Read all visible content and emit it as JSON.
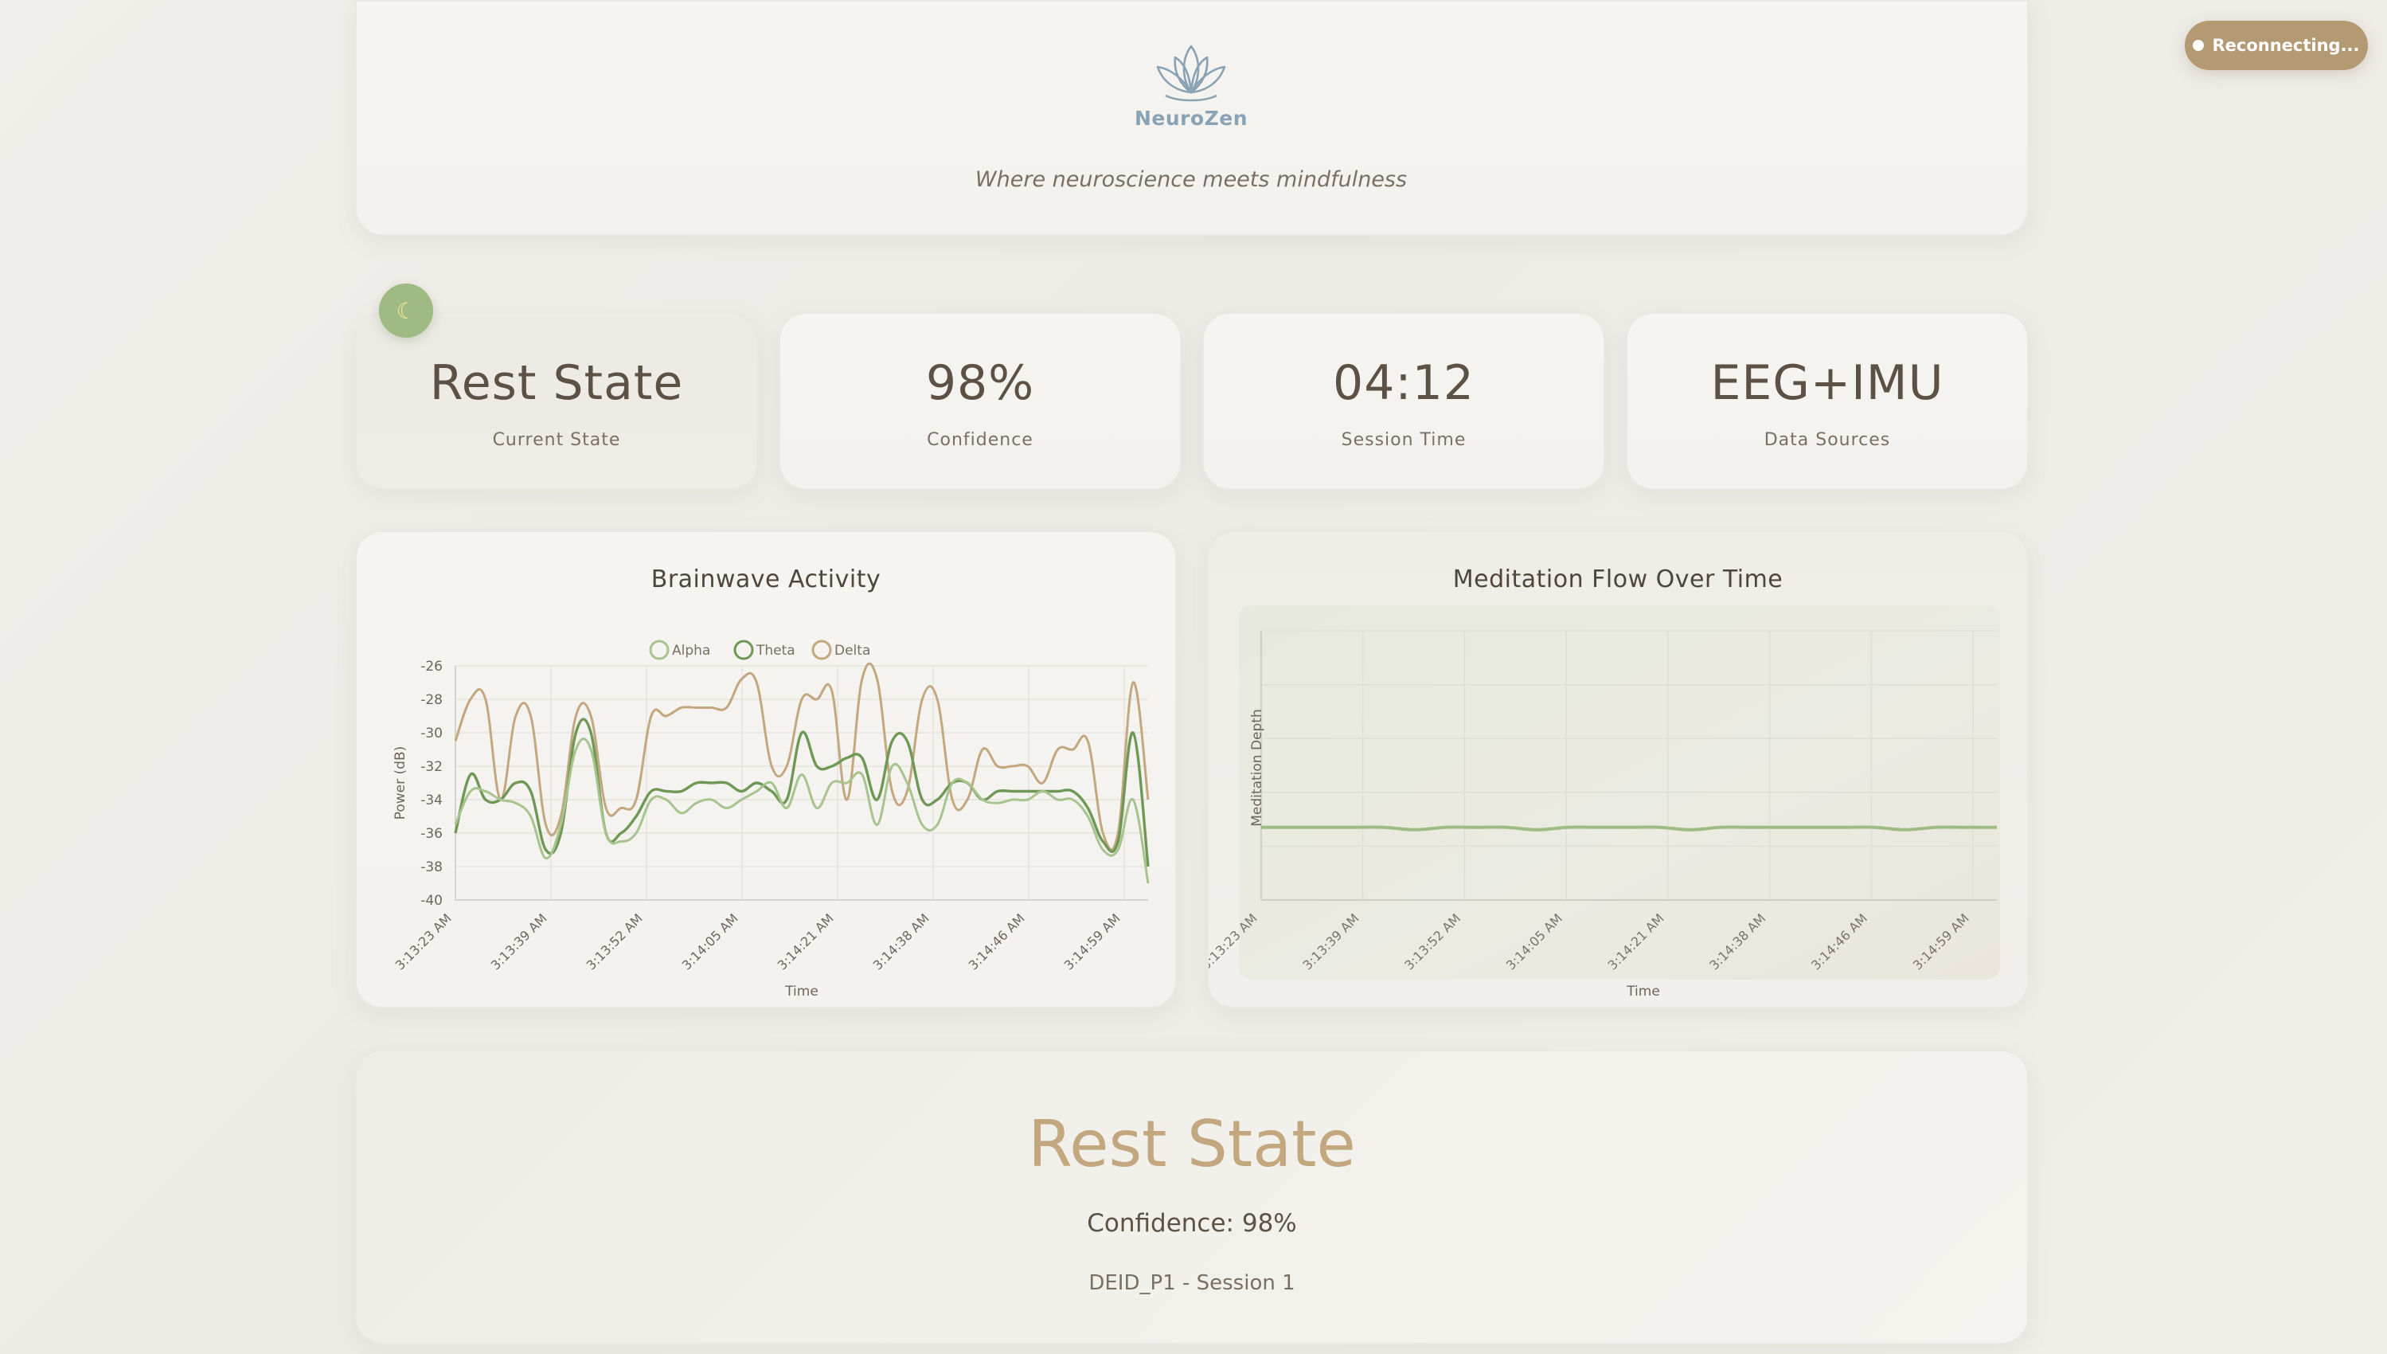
{
  "header": {
    "brand": "NeuroZen",
    "tagline": "Where neuroscience meets mindfulness",
    "logo_icon": "lotus-icon"
  },
  "connection": {
    "status_label": "Reconnecting...",
    "color": "#b49a72"
  },
  "stats": {
    "state_icon": "moon-icon",
    "items": [
      {
        "value": "Rest State",
        "label": "Current State"
      },
      {
        "value": "98%",
        "label": "Confidence"
      },
      {
        "value": "04:12",
        "label": "Session Time"
      },
      {
        "value": "EEG+IMU",
        "label": "Data Sources"
      }
    ]
  },
  "summary": {
    "state": "Rest State",
    "confidence": "Confidence: 98%",
    "session": "DEID_P1 - Session 1"
  },
  "colors": {
    "alpha": "#a7c48f",
    "theta": "#6f9856",
    "delta": "#c2a77f",
    "flow": "#9fbd82"
  },
  "chart_data": [
    {
      "type": "line",
      "title": "Brainwave Activity",
      "xlabel": "Time",
      "ylabel": "Power (dB)",
      "ylim": [
        -40,
        -26
      ],
      "yticks": [
        -26,
        -28,
        -30,
        -32,
        -34,
        -36,
        -38,
        -40
      ],
      "xtick_labels": [
        "3:13:23 AM",
        "3:13:39 AM",
        "3:13:52 AM",
        "3:14:05 AM",
        "3:14:21 AM",
        "3:14:38 AM",
        "3:14:46 AM",
        "3:14:59 AM"
      ],
      "grid": true,
      "legend_position": "top",
      "series": [
        {
          "name": "Alpha",
          "values": [
            -35.5,
            -33.5,
            -33.5,
            -34.0,
            -34.2,
            -35.0,
            -37.5,
            -35.5,
            -31.0,
            -31.0,
            -36.0,
            -36.5,
            -36.0,
            -34.0,
            -34.0,
            -34.8,
            -34.2,
            -34.0,
            -34.5,
            -34.0,
            -33.5,
            -33.0,
            -34.5,
            -32.5,
            -34.5,
            -33.0,
            -33.0,
            -32.5,
            -35.5,
            -32.0,
            -33.0,
            -35.5,
            -35.5,
            -33.0,
            -33.0,
            -34.0,
            -34.2,
            -34.0,
            -34.0,
            -33.5,
            -34.0,
            -34.0,
            -35.0,
            -37.0,
            -37.0,
            -34.0,
            -39.0
          ]
        },
        {
          "name": "Theta",
          "values": [
            -36.0,
            -32.5,
            -34.0,
            -34.0,
            -33.0,
            -33.5,
            -37.0,
            -36.0,
            -30.0,
            -30.0,
            -36.0,
            -36.0,
            -35.0,
            -33.5,
            -33.5,
            -33.5,
            -33.0,
            -33.0,
            -33.0,
            -33.5,
            -33.0,
            -33.5,
            -34.0,
            -30.0,
            -32.0,
            -32.0,
            -31.5,
            -31.5,
            -34.0,
            -30.5,
            -30.5,
            -34.0,
            -34.0,
            -33.0,
            -33.0,
            -34.0,
            -33.5,
            -33.5,
            -33.5,
            -33.5,
            -33.5,
            -33.5,
            -34.5,
            -36.5,
            -36.5,
            -30.0,
            -38.0
          ]
        },
        {
          "name": "Delta",
          "values": [
            -30.5,
            -28.0,
            -28.0,
            -34.0,
            -29.0,
            -29.0,
            -35.5,
            -35.0,
            -29.0,
            -29.0,
            -34.5,
            -34.5,
            -34.0,
            -29.0,
            -29.0,
            -28.5,
            -28.5,
            -28.5,
            -28.5,
            -26.8,
            -27.0,
            -32.0,
            -32.0,
            -28.0,
            -28.0,
            -27.5,
            -34.0,
            -26.8,
            -26.8,
            -33.5,
            -33.5,
            -28.0,
            -28.0,
            -34.0,
            -34.0,
            -31.0,
            -32.0,
            -32.0,
            -32.0,
            -33.0,
            -31.0,
            -31.0,
            -30.5,
            -36.0,
            -36.0,
            -27.0,
            -34.0
          ]
        }
      ]
    },
    {
      "type": "line",
      "title": "Meditation Flow Over Time",
      "xlabel": "Time",
      "ylabel": "Meditation Depth",
      "xtick_labels": [
        "3:13:23 AM",
        "3:13:39 AM",
        "3:13:52 AM",
        "3:14:05 AM",
        "3:14:21 AM",
        "3:14:38 AM",
        "3:14:46 AM",
        "3:14:59 AM"
      ],
      "grid": true,
      "series": [
        {
          "values": [
            0.3,
            0.3,
            0.3,
            0.3,
            0.3,
            0.29,
            0.3,
            0.3,
            0.3,
            0.29,
            0.3,
            0.3,
            0.3,
            0.3,
            0.29,
            0.3,
            0.3,
            0.3,
            0.3,
            0.3,
            0.3,
            0.29,
            0.3,
            0.3,
            0.3
          ]
        }
      ]
    }
  ]
}
